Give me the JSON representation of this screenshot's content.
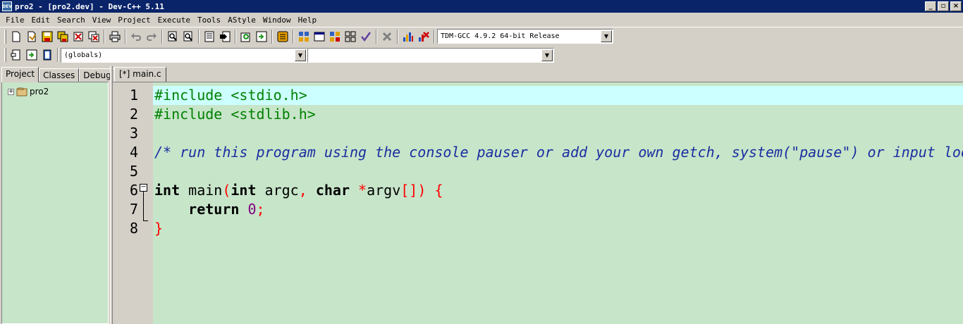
{
  "window": {
    "title": "pro2 - [pro2.dev] - Dev-C++ 5.11",
    "app_icon_text": "DEV",
    "controls": [
      "minimize",
      "maximize",
      "close"
    ]
  },
  "menubar": [
    "File",
    "Edit",
    "Search",
    "View",
    "Project",
    "Execute",
    "Tools",
    "AStyle",
    "Window",
    "Help"
  ],
  "toolbar": {
    "compiler_select": "TDM-GCC 4.9.2 64-bit Release",
    "scope_select": "(globals)",
    "member_select": ""
  },
  "left_panel": {
    "tabs": [
      "Project",
      "Classes",
      "Debug"
    ],
    "active_tab": "Project",
    "tree": [
      {
        "label": "pro2",
        "expander": "+"
      }
    ]
  },
  "editor": {
    "tab_label": "[*] main.c",
    "line_numbers": [
      "1",
      "2",
      "3",
      "4",
      "5",
      "6",
      "7",
      "8"
    ],
    "fold_marker": "−",
    "lines": [
      [
        {
          "t": "pp",
          "v": "#include <stdio.h>"
        }
      ],
      [
        {
          "t": "pp",
          "v": "#include <stdlib.h>"
        }
      ],
      [],
      [
        {
          "t": "cm",
          "v": "/* run this program using the console pauser or add your own getch, system(\"pause\") or input loop */"
        }
      ],
      [],
      [
        {
          "t": "kw",
          "v": "int"
        },
        {
          "t": "tx",
          "v": " main"
        },
        {
          "t": "pn",
          "v": "("
        },
        {
          "t": "kw",
          "v": "int"
        },
        {
          "t": "tx",
          "v": " argc"
        },
        {
          "t": "pn",
          "v": ","
        },
        {
          "t": "tx",
          "v": " "
        },
        {
          "t": "kw",
          "v": "char"
        },
        {
          "t": "tx",
          "v": " "
        },
        {
          "t": "pn",
          "v": "*"
        },
        {
          "t": "tx",
          "v": "argv"
        },
        {
          "t": "pn",
          "v": "[])"
        },
        {
          "t": "tx",
          "v": " "
        },
        {
          "t": "pn",
          "v": "{"
        }
      ],
      [
        {
          "t": "tx",
          "v": "    "
        },
        {
          "t": "kw",
          "v": "return"
        },
        {
          "t": "tx",
          "v": " "
        },
        {
          "t": "nm",
          "v": "0"
        },
        {
          "t": "pn",
          "v": ";"
        }
      ],
      [
        {
          "t": "pn",
          "v": "}"
        }
      ]
    ]
  },
  "colors": {
    "editor_bg": "#c7e5c9",
    "active_line_bg": "#ccffff",
    "titlebar_bg": "#0a246a"
  }
}
